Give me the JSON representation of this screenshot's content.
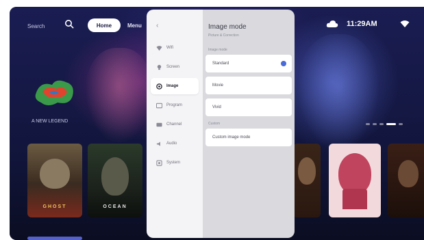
{
  "header": {
    "search_label": "Search",
    "home_label": "Home",
    "menu_label": "Menu",
    "time": "11:29AM"
  },
  "hero": {
    "caption": "A NEW LEGEND",
    "pager_count": 5,
    "pager_active": 4
  },
  "posters": [
    {
      "title": "GHOST"
    },
    {
      "title": "OCEAN"
    },
    {
      "title": ""
    },
    {
      "title": ""
    },
    {
      "title": ""
    }
  ],
  "settings": {
    "back": "‹",
    "nav": [
      {
        "label": "Wifi",
        "icon": "wifi-icon",
        "selected": false
      },
      {
        "label": "Screen",
        "icon": "lightbulb-icon",
        "selected": false
      },
      {
        "label": "Image",
        "icon": "image-icon",
        "selected": true
      },
      {
        "label": "Program",
        "icon": "program-icon",
        "selected": false
      },
      {
        "label": "Channel",
        "icon": "channel-icon",
        "selected": false
      },
      {
        "label": "Audio",
        "icon": "audio-icon",
        "selected": false
      },
      {
        "label": "System",
        "icon": "system-icon",
        "selected": false
      }
    ],
    "title": "Image mode",
    "subtitle": "Picture & Correction",
    "section_modes": "Image mode",
    "options": [
      {
        "label": "Standard",
        "selected": true
      },
      {
        "label": "Movie",
        "selected": false
      },
      {
        "label": "Vivid",
        "selected": false
      }
    ],
    "section_custom": "Custom",
    "custom_option": "Custom image mode"
  },
  "colors": {
    "accent": "#4a6ad8",
    "background": "#12163d"
  }
}
